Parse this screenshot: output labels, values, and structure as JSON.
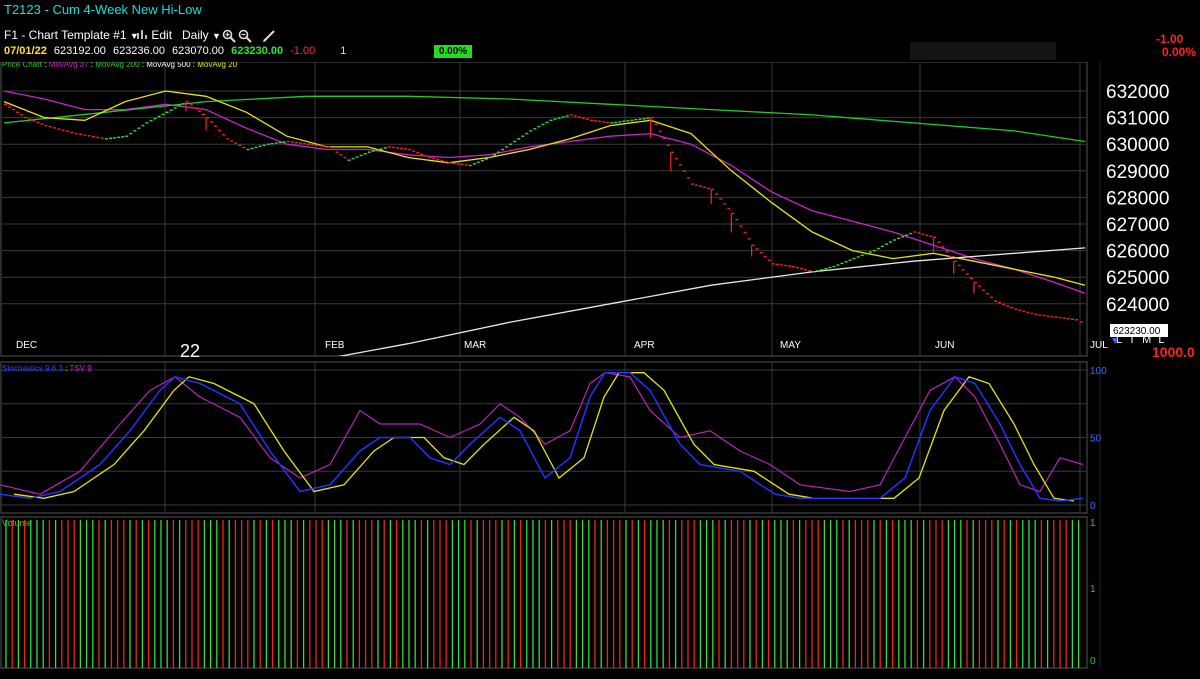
{
  "window": {
    "symbol": "T2123",
    "separator": " - ",
    "name": "Cum 4-Week New Hi-Low"
  },
  "toolbar": {
    "template_label": "F1 - Chart Template #1",
    "edit_label": "Edit",
    "period_label": "Daily",
    "icons": [
      "chevron-down-icon",
      "bar-chart-icon",
      "zoom-in-icon",
      "zoom-out-icon",
      "pencil-icon"
    ]
  },
  "quote": {
    "date": "07/01/22",
    "open": "623192.00",
    "high": "623236.00",
    "low": "623070.00",
    "close": "623230.00",
    "change": "-1.00",
    "flag": "1",
    "pct_badge": "0.00%",
    "right_change": "-1.00",
    "right_pct": "0.00%"
  },
  "colors": {
    "up": "#33dd33",
    "down": "#ee2222",
    "ma37": "#cc22cc",
    "ma200": "#22cc22",
    "ma500": "#e8e8e8",
    "ma20": "#e6e600",
    "stoch_k": "#2233ff",
    "stoch_d": "#e6e600",
    "tsv": "#bb22bb",
    "grid": "#3a3a3a",
    "badge_bg": "#22dd22",
    "axis_text": "#ffffff"
  },
  "price_panel": {
    "legend": [
      {
        "text": "Price Chart",
        "color": "#22cc22"
      },
      {
        "text": " : ",
        "color": "#ffffff"
      },
      {
        "text": "MovAvg 37",
        "color": "#cc22cc"
      },
      {
        "text": " : ",
        "color": "#ffffff"
      },
      {
        "text": "MovAvg 200",
        "color": "#22cc22"
      },
      {
        "text": " : ",
        "color": "#ffffff"
      },
      {
        "text": "MovAvg 500",
        "color": "#ffffff"
      },
      {
        "text": " : ",
        "color": "#ffffff"
      },
      {
        "text": "MovAvg 20",
        "color": "#e6e600"
      }
    ],
    "y_labels": [
      "632000",
      "631000",
      "630000",
      "629000",
      "628000",
      "627000",
      "626000",
      "625000",
      "624000"
    ],
    "x_labels": [
      "DEC",
      "22",
      "FEB",
      "MAR",
      "APR",
      "MAY",
      "JUN",
      "JUL"
    ],
    "last_price_label": "623230.00",
    "mode_letters": "L T M L",
    "scale_label": "1000.0"
  },
  "stoch_panel": {
    "legend": [
      {
        "text": "Stochastics 9.6.3",
        "color": "#3344ff"
      },
      {
        "text": " : ",
        "color": "#ffffff"
      },
      {
        "text": "TSV 9",
        "color": "#cc22cc"
      }
    ],
    "y_labels": [
      "100",
      "50",
      "0"
    ]
  },
  "volume_panel": {
    "legend": "Volume",
    "y_labels": [
      "1",
      "1",
      "0"
    ]
  },
  "chart_data": {
    "type": "line",
    "title": "Cum 4-Week New Hi-Low",
    "x_labels": [
      "DEC",
      "22",
      "FEB",
      "MAR",
      "APR",
      "MAY",
      "JUN",
      "JUL"
    ],
    "ylim": [
      623000,
      633000
    ],
    "series": [
      {
        "name": "Price Chart",
        "values": [
          [
            0,
            631500
          ],
          [
            10,
            631000
          ],
          [
            20,
            630700
          ],
          [
            35,
            630400
          ],
          [
            50,
            630200
          ],
          [
            60,
            630300
          ],
          [
            70,
            630800
          ],
          [
            80,
            631200
          ],
          [
            90,
            631600
          ],
          [
            100,
            631000
          ],
          [
            110,
            630200
          ],
          [
            120,
            629800
          ],
          [
            130,
            630000
          ],
          [
            140,
            630100
          ],
          [
            150,
            630000
          ],
          [
            160,
            629900
          ],
          [
            170,
            629400
          ],
          [
            180,
            629700
          ],
          [
            190,
            629900
          ],
          [
            200,
            629800
          ],
          [
            210,
            629500
          ],
          [
            220,
            629300
          ],
          [
            230,
            629200
          ],
          [
            240,
            629500
          ],
          [
            250,
            630000
          ],
          [
            260,
            630500
          ],
          [
            270,
            630900
          ],
          [
            280,
            631100
          ],
          [
            290,
            630900
          ],
          [
            300,
            630800
          ],
          [
            310,
            630900
          ],
          [
            320,
            631000
          ],
          [
            330,
            629700
          ],
          [
            340,
            628500
          ],
          [
            350,
            628300
          ],
          [
            360,
            627400
          ],
          [
            370,
            626200
          ],
          [
            380,
            625500
          ],
          [
            390,
            625400
          ],
          [
            400,
            625200
          ],
          [
            410,
            625400
          ],
          [
            420,
            625700
          ],
          [
            430,
            626000
          ],
          [
            440,
            626400
          ],
          [
            450,
            626700
          ],
          [
            460,
            626500
          ],
          [
            470,
            625600
          ],
          [
            480,
            624800
          ],
          [
            490,
            624100
          ],
          [
            500,
            623800
          ],
          [
            510,
            623600
          ],
          [
            520,
            623500
          ],
          [
            530,
            623400
          ],
          [
            535,
            623230
          ]
        ]
      },
      {
        "name": "MovAvg 37",
        "values": [
          [
            0,
            632000
          ],
          [
            20,
            631700
          ],
          [
            40,
            631300
          ],
          [
            60,
            631300
          ],
          [
            80,
            631500
          ],
          [
            100,
            631300
          ],
          [
            120,
            630600
          ],
          [
            140,
            630000
          ],
          [
            160,
            629800
          ],
          [
            180,
            629800
          ],
          [
            200,
            629600
          ],
          [
            220,
            629500
          ],
          [
            240,
            629600
          ],
          [
            260,
            629900
          ],
          [
            280,
            630100
          ],
          [
            300,
            630300
          ],
          [
            320,
            630400
          ],
          [
            340,
            630000
          ],
          [
            360,
            629200
          ],
          [
            380,
            628200
          ],
          [
            400,
            627500
          ],
          [
            420,
            627100
          ],
          [
            440,
            626700
          ],
          [
            460,
            626200
          ],
          [
            480,
            625700
          ],
          [
            500,
            625300
          ],
          [
            520,
            624800
          ],
          [
            535,
            624400
          ]
        ]
      },
      {
        "name": "MovAvg 200",
        "values": [
          [
            0,
            630800
          ],
          [
            50,
            631200
          ],
          [
            100,
            631600
          ],
          [
            150,
            631800
          ],
          [
            200,
            631800
          ],
          [
            250,
            631700
          ],
          [
            300,
            631500
          ],
          [
            350,
            631300
          ],
          [
            400,
            631100
          ],
          [
            450,
            630800
          ],
          [
            500,
            630500
          ],
          [
            535,
            630100
          ]
        ]
      },
      {
        "name": "MovAvg 500",
        "values": [
          [
            150,
            621800
          ],
          [
            200,
            622500
          ],
          [
            250,
            623300
          ],
          [
            300,
            624000
          ],
          [
            350,
            624700
          ],
          [
            400,
            625200
          ],
          [
            450,
            625600
          ],
          [
            500,
            625900
          ],
          [
            535,
            626100
          ]
        ]
      },
      {
        "name": "MovAvg 20",
        "values": [
          [
            0,
            631600
          ],
          [
            20,
            631000
          ],
          [
            40,
            630900
          ],
          [
            60,
            631600
          ],
          [
            80,
            632000
          ],
          [
            100,
            631800
          ],
          [
            120,
            631200
          ],
          [
            140,
            630300
          ],
          [
            160,
            629900
          ],
          [
            180,
            629900
          ],
          [
            200,
            629500
          ],
          [
            220,
            629300
          ],
          [
            240,
            629500
          ],
          [
            260,
            629800
          ],
          [
            280,
            630200
          ],
          [
            300,
            630700
          ],
          [
            320,
            630900
          ],
          [
            340,
            630400
          ],
          [
            360,
            629000
          ],
          [
            380,
            627800
          ],
          [
            400,
            626700
          ],
          [
            420,
            626000
          ],
          [
            440,
            625700
          ],
          [
            460,
            625900
          ],
          [
            480,
            625600
          ],
          [
            500,
            625300
          ],
          [
            520,
            625000
          ],
          [
            535,
            624700
          ]
        ]
      }
    ]
  }
}
